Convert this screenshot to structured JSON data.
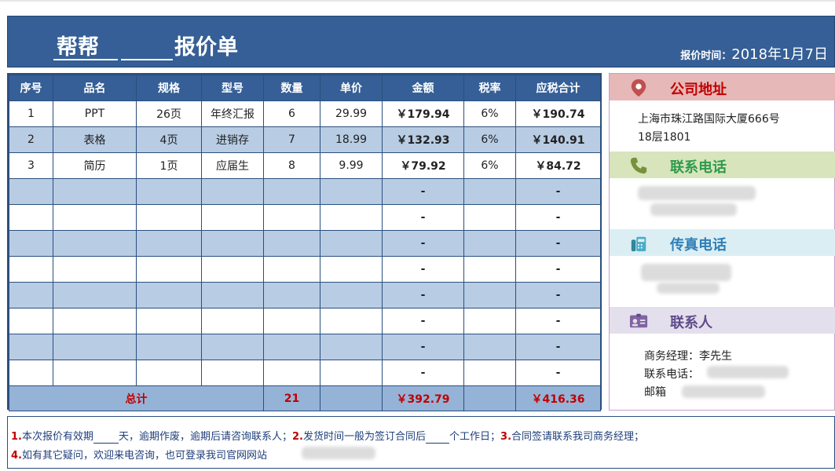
{
  "header": {
    "title": "报价单",
    "title_blank_text": "帮帮",
    "quote_time_label": "报价时间：",
    "quote_time_value": "2018年1月7日"
  },
  "table": {
    "columns": [
      "序号",
      "品名",
      "规格",
      "型号",
      "数量",
      "单价",
      "金额",
      "税率",
      "应税合计"
    ],
    "rows": [
      [
        "1",
        "PPT",
        "26页",
        "年终汇报",
        "6",
        "29.99",
        "￥179.94",
        "6%",
        "￥190.74"
      ],
      [
        "2",
        "表格",
        "4页",
        "进销存",
        "7",
        "18.99",
        "￥132.93",
        "6%",
        "￥140.91"
      ],
      [
        "3",
        "简历",
        "1页",
        "应届生",
        "8",
        "9.99",
        "￥79.92",
        "6%",
        "￥84.72"
      ],
      [
        "",
        "",
        "",
        "",
        "",
        "",
        "-",
        "",
        "-"
      ],
      [
        "",
        "",
        "",
        "",
        "",
        "",
        "-",
        "",
        "-"
      ],
      [
        "",
        "",
        "",
        "",
        "",
        "",
        "-",
        "",
        "-"
      ],
      [
        "",
        "",
        "",
        "",
        "",
        "",
        "-",
        "",
        "-"
      ],
      [
        "",
        "",
        "",
        "",
        "",
        "",
        "-",
        "",
        "-"
      ],
      [
        "",
        "",
        "",
        "",
        "",
        "",
        "-",
        "",
        "-"
      ],
      [
        "",
        "",
        "",
        "",
        "",
        "",
        "-",
        "",
        "-"
      ],
      [
        "",
        "",
        "",
        "",
        "",
        "",
        "-",
        "",
        "-"
      ]
    ],
    "total": {
      "label": "总计",
      "quantity": "21",
      "amount": "￥392.79",
      "taxed_total": "￥416.36"
    }
  },
  "side": {
    "address": {
      "title": "公司地址",
      "icon": "location-pin-icon",
      "color": "#e6b8b7",
      "line1": "上海市珠江路国际大厦666号",
      "line2": "18层1801"
    },
    "phone": {
      "title": "联系电话",
      "icon": "phone-icon",
      "color": "#d8e4bc"
    },
    "fax": {
      "title": "传真电话",
      "icon": "fax-icon",
      "color": "#daeef3"
    },
    "contact": {
      "title": "联系人",
      "icon": "contact-card-icon",
      "color": "#e4dfec",
      "manager_label": "商务经理：",
      "manager_value": "李先生",
      "phone_label": "联系电话：",
      "email_label": "邮箱"
    }
  },
  "notes": {
    "n1": "1.",
    "t1a": "本次报价有效期",
    "t1b": "天，逾期作废，逾期后请咨询联系人；",
    "n2": "2.",
    "t2a": "发货时间一般为签订合同后",
    "t2b": "个工作日；",
    "n3": "3.",
    "t3": "合同签请联系我司商务经理；",
    "n4": "4.",
    "t4": "如有其它疑问，欢迎来电咨询，也可登录我司官网网站"
  },
  "colors": {
    "header_bg": "#355f96",
    "row_alt": "#b8cce4",
    "total_row": "#95b3d7",
    "accent_red": "#c00000",
    "address_text": "#c00000",
    "phone_text": "#2e9b4c",
    "fax_text": "#2f7fb8",
    "contact_text": "#5f4b8b"
  }
}
